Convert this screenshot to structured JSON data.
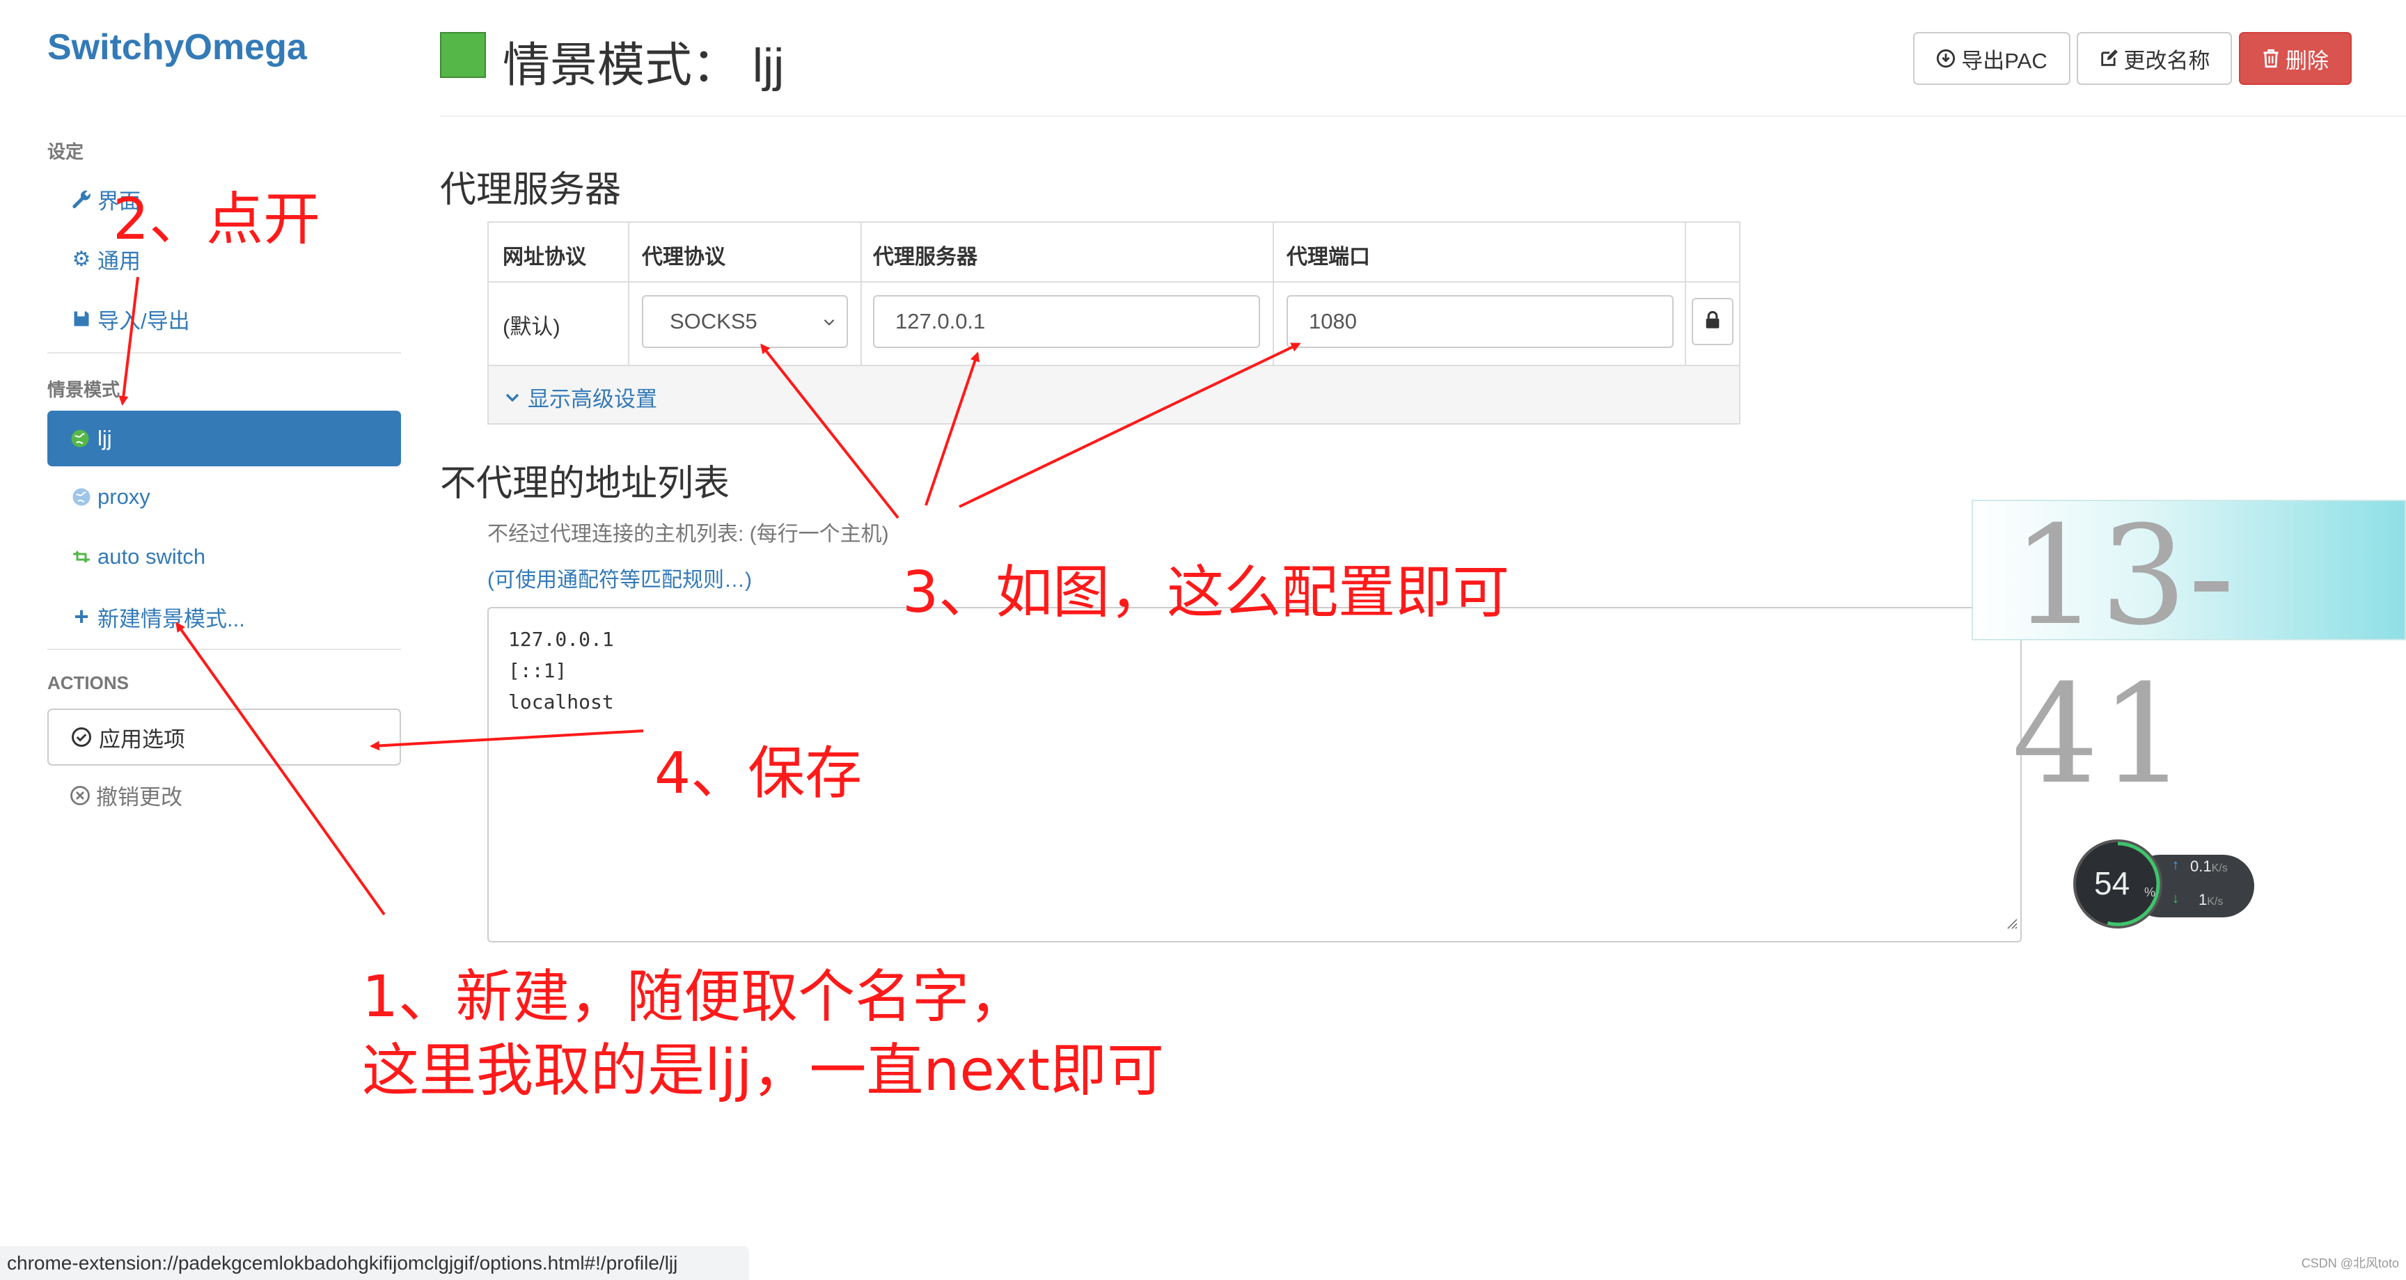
{
  "sidebar": {
    "brand": "SwitchyOmega",
    "settings_heading": "设定",
    "settings_items": [
      {
        "label": "界面",
        "icon": "wrench-icon"
      },
      {
        "label": "通用",
        "icon": "gear-icon"
      },
      {
        "label": "导入/导出",
        "icon": "floppy-icon"
      }
    ],
    "profiles_heading": "情景模式",
    "profiles": [
      {
        "label": "ljj",
        "icon": "globe-icon",
        "active": true
      },
      {
        "label": "proxy",
        "icon": "globe-icon",
        "active": false
      },
      {
        "label": "auto switch",
        "icon": "retweet-icon",
        "active": false
      }
    ],
    "new_profile": "新建情景模式...",
    "actions_heading": "ACTIONS",
    "apply": "应用选项",
    "discard": "撤销更改"
  },
  "header": {
    "title_prefix": "情景模式：",
    "profile_name": "ljj",
    "profile_color": "#55b748",
    "export_pac": "导出PAC",
    "rename": "更改名称",
    "delete": "删除"
  },
  "proxy_servers": {
    "heading": "代理服务器",
    "columns": [
      "网址协议",
      "代理协议",
      "代理服务器",
      "代理端口"
    ],
    "row": {
      "scheme": "(默认)",
      "protocol": "SOCKS5",
      "server": "127.0.0.1",
      "port": "1080"
    },
    "advanced_link": "显示高级设置"
  },
  "bypass": {
    "heading": "不代理的地址列表",
    "description": "不经过代理连接的主机列表: (每行一个主机)",
    "wildcard_link": "(可使用通配符等匹配规则…)",
    "entries": [
      "127.0.0.1",
      "[::1]",
      "localhost"
    ]
  },
  "status_bar": {
    "url": "chrome-extension://padekgcemlokbadohgkifijomclgjgif/options.html#!/profile/ljj"
  },
  "overlay_stamp": "13-41",
  "net_widget": {
    "percent": "54",
    "percent_unit": "%",
    "upload": "0.1",
    "download": "1",
    "unit": "K/s"
  },
  "watermark": "CSDN @北风toto",
  "annotations": {
    "step1_line1": "1、新建，随便取个名字，",
    "step1_line2": "这里我取的是ljj，一直next即可",
    "step2": "2、点开",
    "step3": "3、如图，这么配置即可",
    "step4": "4、保存"
  },
  "colors": {
    "link": "#337ab7",
    "danger": "#d9534f",
    "annotation": "#ff1a1a"
  }
}
